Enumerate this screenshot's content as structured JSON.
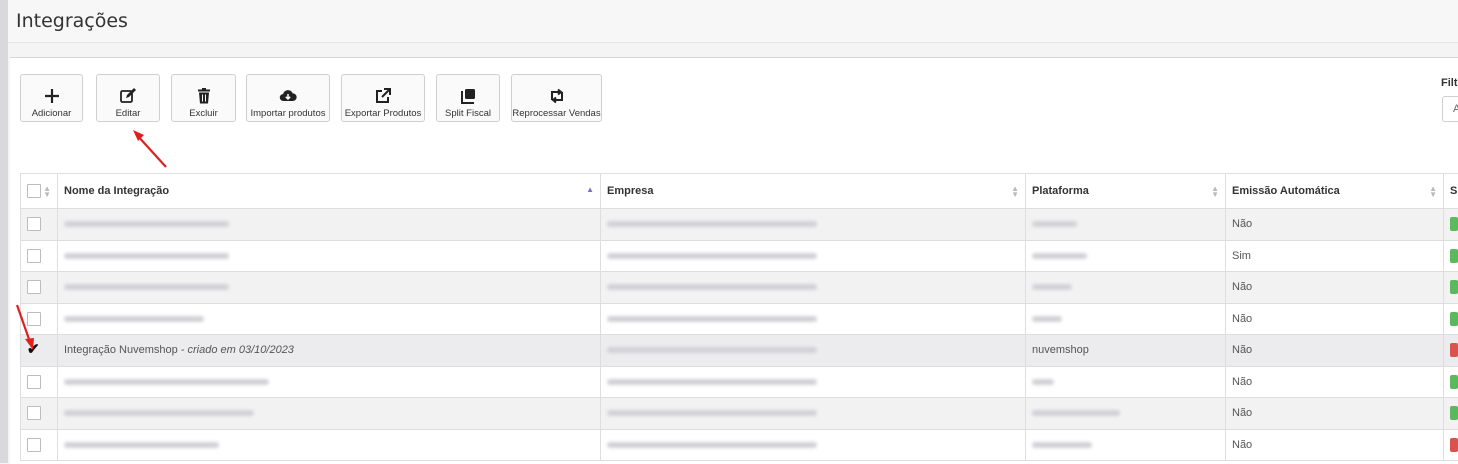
{
  "page": {
    "title": "Integrações"
  },
  "toolbar": {
    "add_label": "Adicionar",
    "edit_label": "Editar",
    "delete_label": "Excluir",
    "import_label": "Importar produtos",
    "export_label": "Exportar Produtos",
    "split_label": "Split Fiscal",
    "reprocess_label": "Reprocessar Vendas"
  },
  "filter": {
    "label": "Filt",
    "value": "A"
  },
  "table": {
    "headers": {
      "name": "Nome da Integração",
      "company": "Empresa",
      "platform": "Plataforma",
      "auto_emission": "Emissão Automática",
      "status": "S"
    },
    "rows": [
      {
        "auto": "Não",
        "status_color": "#5cb85c"
      },
      {
        "auto": "Sim",
        "status_color": "#5cb85c"
      },
      {
        "auto": "Não",
        "status_color": "#5cb85c"
      },
      {
        "auto": "Não",
        "status_color": "#5cb85c"
      },
      {
        "name": "Integração Nuvemshop",
        "created": "- criado em 03/10/2023",
        "platform": "nuvemshop",
        "auto": "Não",
        "status_color": "#d9534f",
        "checked": true
      },
      {
        "auto": "Não",
        "status_color": "#5cb85c"
      },
      {
        "auto": "Não",
        "status_color": "#5cb85c"
      },
      {
        "auto": "Não",
        "status_color": "#d9534f"
      }
    ]
  },
  "colors": {
    "accent_arrow": "#e02020",
    "sort_active": "#7d6fc6",
    "status_ok": "#5cb85c",
    "status_error": "#d9534f"
  }
}
